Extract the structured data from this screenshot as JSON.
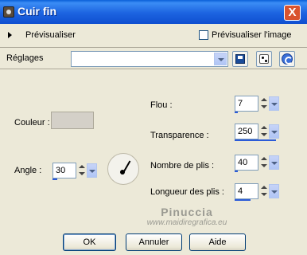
{
  "window": {
    "title": "Cuir fin",
    "close_glyph": "X"
  },
  "preview": {
    "label": "Prévisualiser",
    "image_checkbox_label": "Prévisualiser l'image",
    "image_checked": false
  },
  "presets": {
    "label": "Réglages",
    "value": ""
  },
  "settings": {
    "color": {
      "label": "Couleur :",
      "value": "#d4d0c8"
    },
    "angle": {
      "label": "Angle :",
      "value": "30"
    },
    "blur": {
      "label": "Flou :",
      "value": "7"
    },
    "transparency": {
      "label": "Transparence :",
      "value": "250"
    },
    "fold_count": {
      "label": "Nombre de plis :",
      "value": "40"
    },
    "fold_length": {
      "label": "Longueur des plis :",
      "value": "4"
    }
  },
  "watermark": {
    "name": "Pinuccia",
    "url": "www.maidiregrafica.eu"
  },
  "buttons": {
    "ok": "OK",
    "cancel": "Annuler",
    "help": "Aide"
  },
  "icons": [
    "app-icon",
    "close-icon",
    "expand-triangle-icon",
    "save-icon",
    "random-dice-icon",
    "reset-icon",
    "angle-dial-icon"
  ]
}
